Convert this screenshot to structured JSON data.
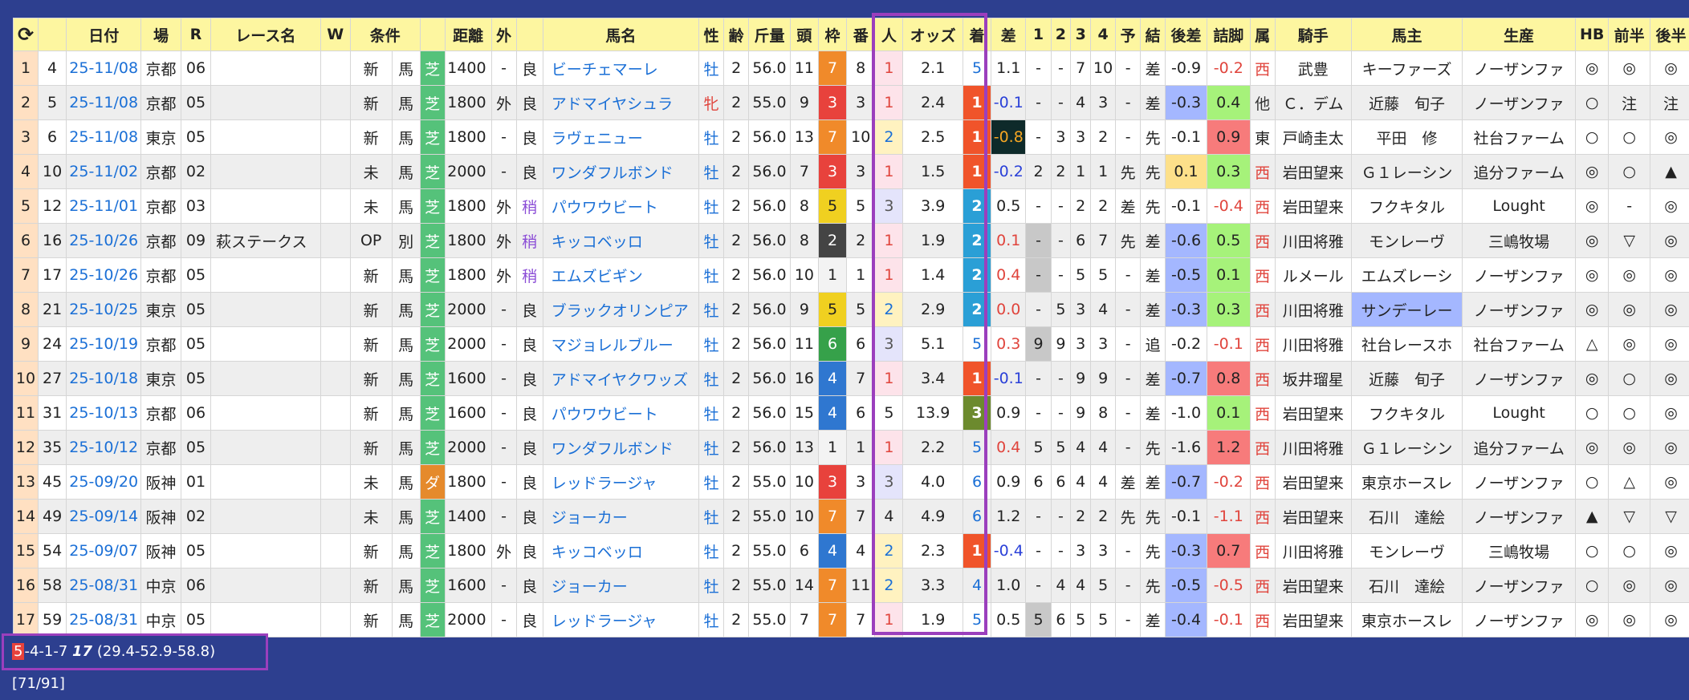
{
  "headers": [
    "⟳",
    "",
    "日付",
    "場",
    "R",
    "レース名",
    "W",
    "条件",
    "",
    "距離",
    "外",
    "",
    "馬名",
    "性",
    "齢",
    "斤量",
    "頭",
    "枠",
    "番",
    "人",
    "オッズ",
    "着",
    "差",
    "1",
    "2",
    "3",
    "4",
    "予",
    "結",
    "後差",
    "詰脚",
    "属",
    "騎手",
    "馬主",
    "生産",
    "HB",
    "前半",
    "後半"
  ],
  "rows": [
    {
      "idx": "1",
      "num": "4",
      "date": "25-11/08",
      "venue": "京都",
      "race": "06",
      "rname": "",
      "w": "",
      "cond": "新",
      "cls": "馬",
      "surf": "芝",
      "dist": "1400",
      "out": "-",
      "going": "良",
      "horse": "ビーチェマーレ",
      "sex": "牡",
      "age": "2",
      "kin": "56.0",
      "heads": "11",
      "waku": "7",
      "ban": "8",
      "pop": "1",
      "odds": "2.1",
      "fin": "5",
      "diff": "1.1",
      "p1": "-",
      "p2": "-",
      "p3": "7",
      "p4": "10",
      "yo": "-",
      "res": "差",
      "kosa": "-0.9",
      "tsume": "-0.2",
      "zoku": "西",
      "jockey": "武豊",
      "owner": "キーファーズ",
      "breeder": "ノーザンファ",
      "hb": "◎",
      "zh": "◎",
      "kh": "◎"
    },
    {
      "idx": "2",
      "num": "5",
      "date": "25-11/08",
      "venue": "京都",
      "race": "05",
      "rname": "",
      "w": "",
      "cond": "新",
      "cls": "馬",
      "surf": "芝",
      "dist": "1800",
      "out": "外",
      "going": "良",
      "horse": "アドマイヤシュラ",
      "sex": "牝",
      "age": "2",
      "kin": "55.0",
      "heads": "9",
      "waku": "3",
      "ban": "3",
      "pop": "1",
      "odds": "2.4",
      "fin": "1",
      "diff": "-0.1",
      "p1": "-",
      "p2": "-",
      "p3": "4",
      "p4": "3",
      "yo": "-",
      "res": "差",
      "kosa": "-0.3",
      "tsume": "0.4",
      "zoku": "他",
      "jockey": "Ｃ．デム",
      "owner": "近藤　旬子",
      "breeder": "ノーザンファ",
      "hb": "○",
      "zh": "注",
      "kh": "注"
    },
    {
      "idx": "3",
      "num": "6",
      "date": "25-11/08",
      "venue": "東京",
      "race": "05",
      "rname": "",
      "w": "",
      "cond": "新",
      "cls": "馬",
      "surf": "芝",
      "dist": "1800",
      "out": "-",
      "going": "良",
      "horse": "ラヴェニュー",
      "sex": "牡",
      "age": "2",
      "kin": "56.0",
      "heads": "13",
      "waku": "7",
      "ban": "10",
      "pop": "2",
      "odds": "2.5",
      "fin": "1",
      "diff": "-0.8",
      "p1": "-",
      "p2": "3",
      "p3": "3",
      "p4": "2",
      "yo": "-",
      "res": "先",
      "kosa": "-0.1",
      "tsume": "0.9",
      "zoku": "東",
      "jockey": "戸崎圭太",
      "owner": "平田　修",
      "breeder": "社台ファーム",
      "hb": "○",
      "zh": "○",
      "kh": "◎"
    },
    {
      "idx": "4",
      "num": "10",
      "date": "25-11/02",
      "venue": "京都",
      "race": "02",
      "rname": "",
      "w": "",
      "cond": "未",
      "cls": "馬",
      "surf": "芝",
      "dist": "2000",
      "out": "-",
      "going": "良",
      "horse": "ワンダフルボンド",
      "sex": "牡",
      "age": "2",
      "kin": "56.0",
      "heads": "7",
      "waku": "3",
      "ban": "3",
      "pop": "1",
      "odds": "1.5",
      "fin": "1",
      "diff": "-0.2",
      "p1": "2",
      "p2": "2",
      "p3": "1",
      "p4": "1",
      "yo": "先",
      "res": "先",
      "kosa": "0.1",
      "tsume": "0.3",
      "zoku": "西",
      "jockey": "岩田望来",
      "owner": "Ｇ１レーシン",
      "breeder": "追分ファーム",
      "hb": "◎",
      "zh": "○",
      "kh": "▲"
    },
    {
      "idx": "5",
      "num": "12",
      "date": "25-11/01",
      "venue": "京都",
      "race": "03",
      "rname": "",
      "w": "",
      "cond": "未",
      "cls": "馬",
      "surf": "芝",
      "dist": "1800",
      "out": "外",
      "going": "稍",
      "horse": "パウワウビート",
      "sex": "牡",
      "age": "2",
      "kin": "56.0",
      "heads": "8",
      "waku": "5",
      "ban": "5",
      "pop": "3",
      "odds": "3.9",
      "fin": "2",
      "diff": "0.5",
      "p1": "-",
      "p2": "-",
      "p3": "2",
      "p4": "2",
      "yo": "差",
      "res": "先",
      "kosa": "-0.1",
      "tsume": "-0.4",
      "zoku": "西",
      "jockey": "岩田望来",
      "owner": "フクキタル",
      "breeder": "Lought",
      "hb": "◎",
      "zh": "-",
      "kh": "◎"
    },
    {
      "idx": "6",
      "num": "16",
      "date": "25-10/26",
      "venue": "京都",
      "race": "09",
      "rname": "萩ステークス",
      "w": "",
      "cond": "OP",
      "cls": "別",
      "surf": "芝",
      "dist": "1800",
      "out": "外",
      "going": "稍",
      "horse": "キッコベッロ",
      "sex": "牡",
      "age": "2",
      "kin": "56.0",
      "heads": "8",
      "waku": "2",
      "ban": "2",
      "pop": "1",
      "odds": "1.9",
      "fin": "2",
      "diff": "0.1",
      "p1": "-",
      "p2": "-",
      "p3": "6",
      "p4": "7",
      "yo": "先",
      "res": "差",
      "kosa": "-0.6",
      "tsume": "0.5",
      "zoku": "西",
      "jockey": "川田将雅",
      "owner": "モンレーヴ",
      "breeder": "三嶋牧場",
      "hb": "◎",
      "zh": "▽",
      "kh": "◎"
    },
    {
      "idx": "7",
      "num": "17",
      "date": "25-10/26",
      "venue": "京都",
      "race": "05",
      "rname": "",
      "w": "",
      "cond": "新",
      "cls": "馬",
      "surf": "芝",
      "dist": "1800",
      "out": "外",
      "going": "稍",
      "horse": "エムズビギン",
      "sex": "牡",
      "age": "2",
      "kin": "56.0",
      "heads": "10",
      "waku": "1",
      "ban": "1",
      "pop": "1",
      "odds": "1.4",
      "fin": "2",
      "diff": "0.4",
      "p1": "-",
      "p2": "-",
      "p3": "5",
      "p4": "5",
      "yo": "-",
      "res": "差",
      "kosa": "-0.5",
      "tsume": "0.1",
      "zoku": "西",
      "jockey": "ルメール",
      "owner": "エムズレーシ",
      "breeder": "ノーザンファ",
      "hb": "◎",
      "zh": "◎",
      "kh": "◎"
    },
    {
      "idx": "8",
      "num": "21",
      "date": "25-10/25",
      "venue": "東京",
      "race": "05",
      "rname": "",
      "w": "",
      "cond": "新",
      "cls": "馬",
      "surf": "芝",
      "dist": "2000",
      "out": "-",
      "going": "良",
      "horse": "ブラックオリンピア",
      "sex": "牡",
      "age": "2",
      "kin": "56.0",
      "heads": "9",
      "waku": "5",
      "ban": "5",
      "pop": "2",
      "odds": "2.9",
      "fin": "2",
      "diff": "0.0",
      "p1": "-",
      "p2": "5",
      "p3": "3",
      "p4": "4",
      "yo": "-",
      "res": "差",
      "kosa": "-0.3",
      "tsume": "0.3",
      "zoku": "西",
      "jockey": "川田将雅",
      "owner": "サンデーレー",
      "breeder": "ノーザンファ",
      "hb": "◎",
      "zh": "◎",
      "kh": "◎"
    },
    {
      "idx": "9",
      "num": "24",
      "date": "25-10/19",
      "venue": "京都",
      "race": "05",
      "rname": "",
      "w": "",
      "cond": "新",
      "cls": "馬",
      "surf": "芝",
      "dist": "2000",
      "out": "-",
      "going": "良",
      "horse": "マジョレルブルー",
      "sex": "牡",
      "age": "2",
      "kin": "56.0",
      "heads": "11",
      "waku": "6",
      "ban": "6",
      "pop": "3",
      "odds": "5.1",
      "fin": "5",
      "diff": "0.3",
      "p1": "9",
      "p2": "9",
      "p3": "3",
      "p4": "3",
      "yo": "-",
      "res": "追",
      "kosa": "-0.2",
      "tsume": "-0.1",
      "zoku": "西",
      "jockey": "川田将雅",
      "owner": "社台レースホ",
      "breeder": "社台ファーム",
      "hb": "△",
      "zh": "◎",
      "kh": "◎"
    },
    {
      "idx": "10",
      "num": "27",
      "date": "25-10/18",
      "venue": "東京",
      "race": "05",
      "rname": "",
      "w": "",
      "cond": "新",
      "cls": "馬",
      "surf": "芝",
      "dist": "1600",
      "out": "-",
      "going": "良",
      "horse": "アドマイヤクワッズ",
      "sex": "牡",
      "age": "2",
      "kin": "56.0",
      "heads": "16",
      "waku": "4",
      "ban": "7",
      "pop": "1",
      "odds": "3.4",
      "fin": "1",
      "diff": "-0.1",
      "p1": "-",
      "p2": "-",
      "p3": "9",
      "p4": "9",
      "yo": "-",
      "res": "差",
      "kosa": "-0.7",
      "tsume": "0.8",
      "zoku": "西",
      "jockey": "坂井瑠星",
      "owner": "近藤　旬子",
      "breeder": "ノーザンファ",
      "hb": "◎",
      "zh": "○",
      "kh": "◎"
    },
    {
      "idx": "11",
      "num": "31",
      "date": "25-10/13",
      "venue": "京都",
      "race": "06",
      "rname": "",
      "w": "",
      "cond": "新",
      "cls": "馬",
      "surf": "芝",
      "dist": "1600",
      "out": "-",
      "going": "良",
      "horse": "パウワウビート",
      "sex": "牡",
      "age": "2",
      "kin": "56.0",
      "heads": "15",
      "waku": "4",
      "ban": "6",
      "pop": "5",
      "odds": "13.9",
      "fin": "3",
      "diff": "0.9",
      "p1": "-",
      "p2": "-",
      "p3": "9",
      "p4": "8",
      "yo": "-",
      "res": "差",
      "kosa": "-1.0",
      "tsume": "0.1",
      "zoku": "西",
      "jockey": "岩田望来",
      "owner": "フクキタル",
      "breeder": "Lought",
      "hb": "○",
      "zh": "○",
      "kh": "◎"
    },
    {
      "idx": "12",
      "num": "35",
      "date": "25-10/12",
      "venue": "京都",
      "race": "05",
      "rname": "",
      "w": "",
      "cond": "新",
      "cls": "馬",
      "surf": "芝",
      "dist": "2000",
      "out": "-",
      "going": "良",
      "horse": "ワンダフルボンド",
      "sex": "牡",
      "age": "2",
      "kin": "56.0",
      "heads": "13",
      "waku": "1",
      "ban": "1",
      "pop": "1",
      "odds": "2.2",
      "fin": "5",
      "diff": "0.4",
      "p1": "5",
      "p2": "5",
      "p3": "4",
      "p4": "4",
      "yo": "-",
      "res": "先",
      "kosa": "-1.6",
      "tsume": "1.2",
      "zoku": "西",
      "jockey": "川田将雅",
      "owner": "Ｇ１レーシン",
      "breeder": "追分ファーム",
      "hb": "◎",
      "zh": "◎",
      "kh": "◎"
    },
    {
      "idx": "13",
      "num": "45",
      "date": "25-09/20",
      "venue": "阪神",
      "race": "01",
      "rname": "",
      "w": "",
      "cond": "未",
      "cls": "馬",
      "surf": "ダ",
      "dist": "1800",
      "out": "-",
      "going": "良",
      "horse": "レッドラージャ",
      "sex": "牡",
      "age": "2",
      "kin": "55.0",
      "heads": "10",
      "waku": "3",
      "ban": "3",
      "pop": "3",
      "odds": "4.0",
      "fin": "6",
      "diff": "0.9",
      "p1": "6",
      "p2": "6",
      "p3": "4",
      "p4": "4",
      "yo": "差",
      "res": "差",
      "kosa": "-0.7",
      "tsume": "-0.2",
      "zoku": "西",
      "jockey": "岩田望来",
      "owner": "東京ホースレ",
      "breeder": "ノーザンファ",
      "hb": "○",
      "zh": "△",
      "kh": "◎"
    },
    {
      "idx": "14",
      "num": "49",
      "date": "25-09/14",
      "venue": "阪神",
      "race": "02",
      "rname": "",
      "w": "",
      "cond": "未",
      "cls": "馬",
      "surf": "芝",
      "dist": "1400",
      "out": "-",
      "going": "良",
      "horse": "ジョーカー",
      "sex": "牡",
      "age": "2",
      "kin": "55.0",
      "heads": "10",
      "waku": "7",
      "ban": "7",
      "pop": "4",
      "odds": "4.9",
      "fin": "6",
      "diff": "1.2",
      "p1": "-",
      "p2": "-",
      "p3": "2",
      "p4": "2",
      "yo": "先",
      "res": "先",
      "kosa": "-0.1",
      "tsume": "-1.1",
      "zoku": "西",
      "jockey": "岩田望来",
      "owner": "石川　達絵",
      "breeder": "ノーザンファ",
      "hb": "▲",
      "zh": "▽",
      "kh": "▽"
    },
    {
      "idx": "15",
      "num": "54",
      "date": "25-09/07",
      "venue": "阪神",
      "race": "05",
      "rname": "",
      "w": "",
      "cond": "新",
      "cls": "馬",
      "surf": "芝",
      "dist": "1800",
      "out": "外",
      "going": "良",
      "horse": "キッコベッロ",
      "sex": "牡",
      "age": "2",
      "kin": "55.0",
      "heads": "6",
      "waku": "4",
      "ban": "4",
      "pop": "2",
      "odds": "2.3",
      "fin": "1",
      "diff": "-0.4",
      "p1": "-",
      "p2": "-",
      "p3": "3",
      "p4": "3",
      "yo": "-",
      "res": "先",
      "kosa": "-0.3",
      "tsume": "0.7",
      "zoku": "西",
      "jockey": "川田将雅",
      "owner": "モンレーヴ",
      "breeder": "三嶋牧場",
      "hb": "○",
      "zh": "○",
      "kh": "◎"
    },
    {
      "idx": "16",
      "num": "58",
      "date": "25-08/31",
      "venue": "中京",
      "race": "06",
      "rname": "",
      "w": "",
      "cond": "新",
      "cls": "馬",
      "surf": "芝",
      "dist": "1600",
      "out": "-",
      "going": "良",
      "horse": "ジョーカー",
      "sex": "牡",
      "age": "2",
      "kin": "55.0",
      "heads": "14",
      "waku": "7",
      "ban": "11",
      "pop": "2",
      "odds": "3.3",
      "fin": "4",
      "diff": "1.0",
      "p1": "-",
      "p2": "4",
      "p3": "4",
      "p4": "5",
      "yo": "-",
      "res": "先",
      "kosa": "-0.5",
      "tsume": "-0.5",
      "zoku": "西",
      "jockey": "岩田望来",
      "owner": "石川　達絵",
      "breeder": "ノーザンファ",
      "hb": "○",
      "zh": "◎",
      "kh": "◎"
    },
    {
      "idx": "17",
      "num": "59",
      "date": "25-08/31",
      "venue": "中京",
      "race": "05",
      "rname": "",
      "w": "",
      "cond": "新",
      "cls": "馬",
      "surf": "芝",
      "dist": "2000",
      "out": "-",
      "going": "良",
      "horse": "レッドラージャ",
      "sex": "牡",
      "age": "2",
      "kin": "55.0",
      "heads": "7",
      "waku": "7",
      "ban": "7",
      "pop": "1",
      "odds": "1.9",
      "fin": "5",
      "diff": "0.5",
      "p1": "5",
      "p2": "6",
      "p3": "5",
      "p4": "5",
      "yo": "-",
      "res": "差",
      "kosa": "-0.4",
      "tsume": "-0.1",
      "zoku": "西",
      "jockey": "岩田望来",
      "owner": "東京ホースレ",
      "breeder": "ノーザンファ",
      "hb": "◎",
      "zh": "◎",
      "kh": "◎"
    }
  ],
  "status": {
    "win": "5",
    "rest": "-4-1-7 ",
    "bold": "17",
    "tail": " (29.4-52.9-58.8) [71/91]"
  },
  "colors": {
    "background": "#2d3f8f",
    "header": "#fdf6a0",
    "frame": "#9b3fbd",
    "win": "#f0542a",
    "second": "#2a9fd6",
    "third": "#6c8a2e"
  }
}
